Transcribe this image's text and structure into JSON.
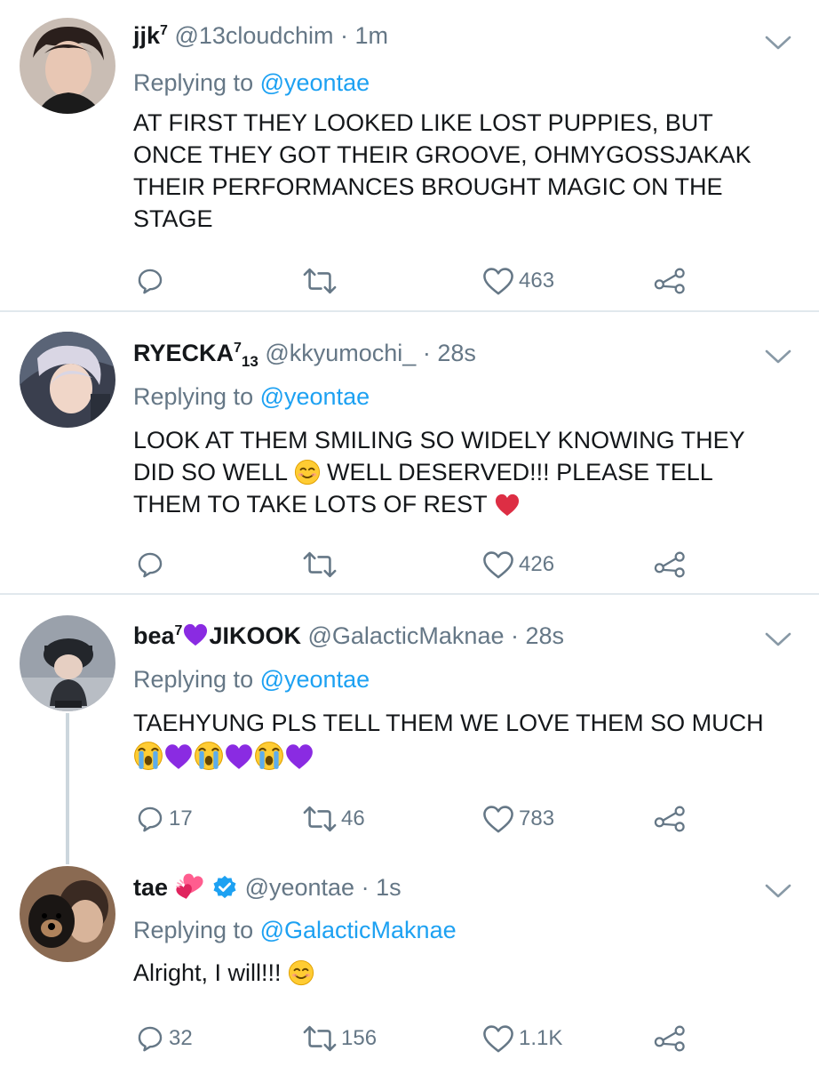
{
  "tweets": [
    {
      "name": "jjk",
      "name_sup": "7",
      "handle": "@13cloudchim",
      "time": "1m",
      "replying_prefix": "Replying to",
      "replying_to": "@yeontae",
      "text": "AT FIRST THEY LOOKED LIKE LOST PUPPIES, BUT\nONCE THEY GOT THEIR GROOVE, OHMYGOSSJAKAK\nTHEIR PERFORMANCES BROUGHT MAGIC ON THE\nSTAGE",
      "replies": "",
      "retweets": "",
      "likes": "463"
    },
    {
      "name": "RYECKA",
      "name_sup": "7",
      "name_sub": "13",
      "handle": "@kkyumochi_",
      "time": "28s",
      "replying_prefix": "Replying to",
      "replying_to": "@yeontae",
      "text_line1": "LOOK AT THEM SMILING SO WIDELY KNOWING THEY",
      "text_line2a": "DID SO WELL ",
      "text_line2b": " WELL DESERVED!!! PLEASE TELL",
      "text_line3": "THEM TO TAKE LOTS OF REST ",
      "replies": "",
      "retweets": "",
      "likes": "426"
    },
    {
      "name": "bea",
      "name_sup": "7",
      "name_suffix": "JIKOOK",
      "handle": "@GalacticMaknae",
      "time": "28s",
      "replying_prefix": "Replying to",
      "replying_to": "@yeontae",
      "text": "TAEHYUNG PLS TELL THEM WE LOVE THEM SO MUCH",
      "replies": "17",
      "retweets": "46",
      "likes": "783"
    },
    {
      "name": "tae",
      "handle": "@yeontae",
      "time": "1s",
      "replying_prefix": "Replying to",
      "replying_to": "@GalacticMaknae",
      "text": "Alright, I will!!! ",
      "replies": "32",
      "retweets": "156",
      "likes": "1.1K"
    }
  ],
  "separator": "·",
  "icons": {
    "reply": "reply-bubble-icon",
    "retweet": "retweet-icon",
    "like": "heart-outline-icon",
    "share": "share-icon",
    "caret": "chevron-down-icon",
    "verified": "verified-badge-icon"
  },
  "colors": {
    "link": "#1da1f2",
    "secondary_text": "#657786",
    "divider": "#e1e8ed",
    "thread_line": "#ccd6dd",
    "purple_heart": "#7b2fbe",
    "red_heart": "#e0245e"
  }
}
